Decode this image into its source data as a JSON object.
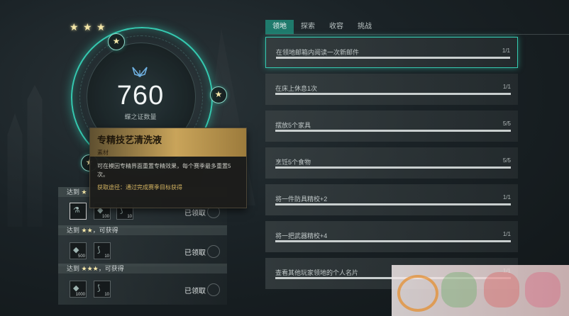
{
  "counter": {
    "value": "760",
    "label": "蝶之证数量",
    "stars": 3
  },
  "tooltip": {
    "title": "专精技艺清洗液",
    "category": "素材",
    "description": "可在模因专精界面重置专精效果，每个赛季最多重置5次。",
    "source": "获取途径：通过完成赛季目标获得"
  },
  "rewards": [
    {
      "prefix": "达到",
      "stars": "★",
      "suffix": "",
      "items": [
        {
          "icon": "potion-icon",
          "count": ""
        },
        {
          "icon": "crystal-icon",
          "count": "100"
        },
        {
          "icon": "feather-icon",
          "count": "10"
        }
      ],
      "status": "已领取"
    },
    {
      "prefix": "达到",
      "stars": "★★",
      "suffix": "，可获得",
      "items": [
        {
          "icon": "crystal-icon",
          "count": "500"
        },
        {
          "icon": "feather-icon",
          "count": "10"
        }
      ],
      "status": "已领取"
    },
    {
      "prefix": "达到",
      "stars": "★★★",
      "suffix": "，可获得",
      "items": [
        {
          "icon": "crystal-icon",
          "count": "1000"
        },
        {
          "icon": "feather-icon",
          "count": "10"
        }
      ],
      "status": "已领取"
    }
  ],
  "tabs": [
    "领地",
    "探索",
    "收容",
    "挑战"
  ],
  "active_tab": 0,
  "tasks": [
    {
      "label": "在领地邮箱内阅读一次新邮件",
      "progress": "1/1",
      "fraction": 1.0
    },
    {
      "label": "在床上休息1次",
      "progress": "1/1",
      "fraction": 1.0
    },
    {
      "label": "摆放5个家具",
      "progress": "5/5",
      "fraction": 1.0
    },
    {
      "label": "烹饪5个食物",
      "progress": "5/5",
      "fraction": 1.0
    },
    {
      "label": "将一件防具精校+2",
      "progress": "1/1",
      "fraction": 1.0
    },
    {
      "label": "将一把武器精校+4",
      "progress": "1/1",
      "fraction": 1.0
    },
    {
      "label": "查看其他玩家领地的个人名片",
      "progress": "1/1",
      "fraction": 1.0
    }
  ],
  "colors": {
    "accent": "#35c9b0",
    "star": "#f5e7a8",
    "tooltip_gold": "#c9a45a",
    "tab_active": "#1f7a6c"
  }
}
